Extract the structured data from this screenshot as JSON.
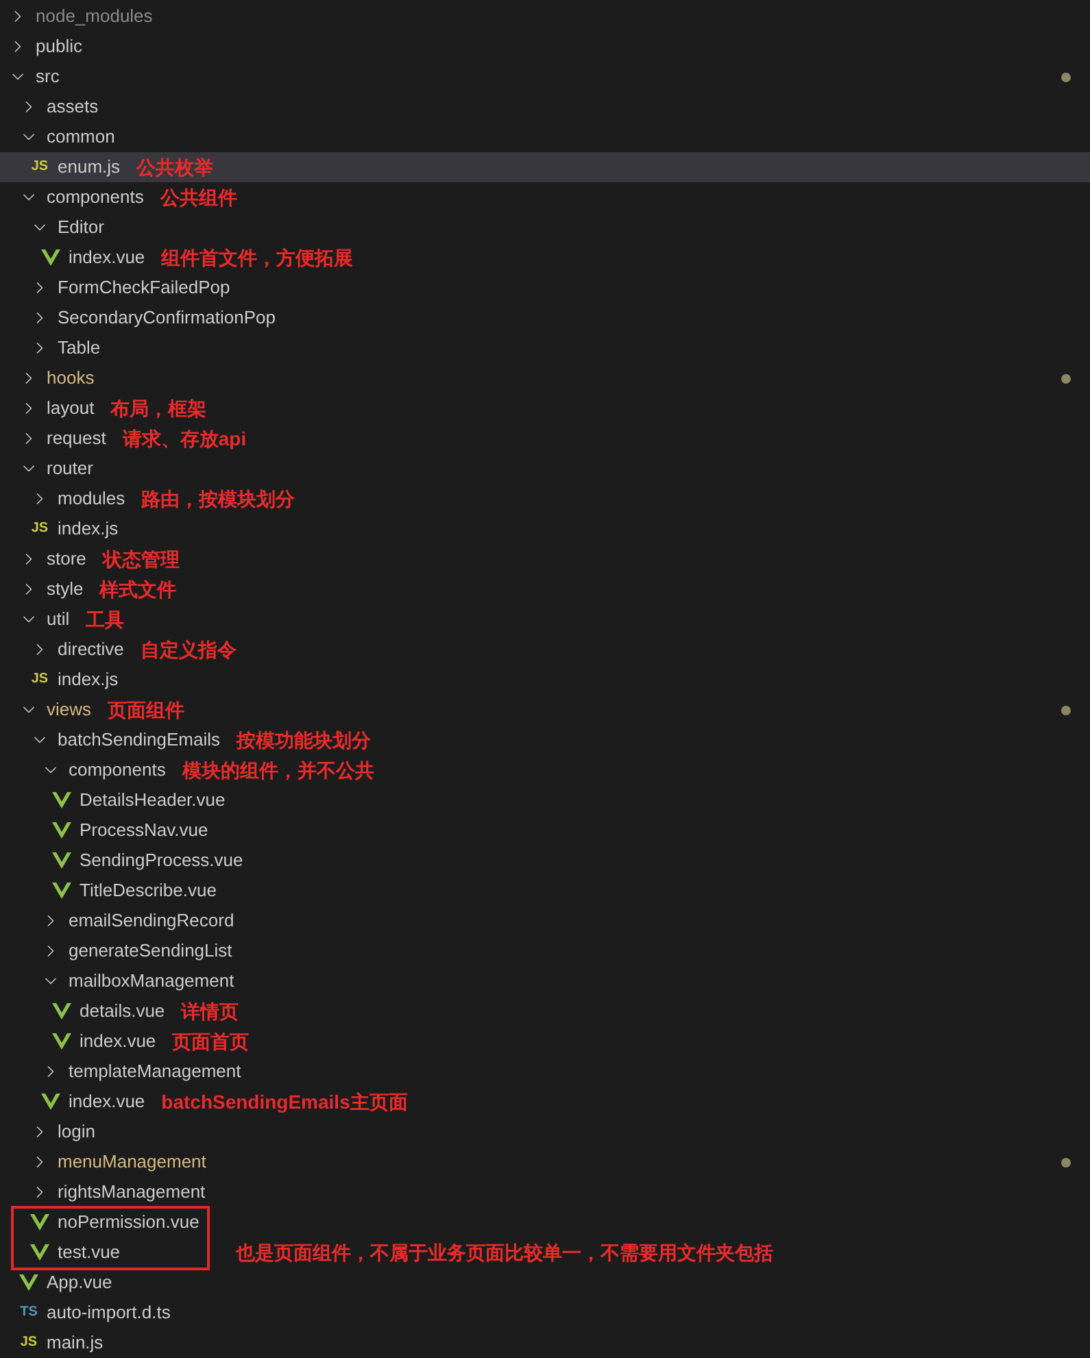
{
  "explorer": {
    "tree": [
      {
        "name": "node_modules",
        "kind": "folder",
        "expanded": false,
        "ignored": true,
        "modified": false,
        "changed": false,
        "selected": false
      },
      {
        "name": "public",
        "kind": "folder",
        "expanded": false,
        "ignored": false,
        "modified": false,
        "changed": false,
        "selected": false
      },
      {
        "name": "src",
        "kind": "folder",
        "expanded": true,
        "ignored": false,
        "modified": false,
        "changed": true,
        "selected": false,
        "children": [
          {
            "name": "assets",
            "kind": "folder",
            "expanded": false,
            "ignored": false,
            "modified": false,
            "changed": false,
            "selected": false
          },
          {
            "name": "common",
            "kind": "folder",
            "expanded": true,
            "ignored": false,
            "modified": false,
            "changed": false,
            "selected": false,
            "children": [
              {
                "name": "enum.js",
                "kind": "js",
                "badge": "JS",
                "ignored": false,
                "modified": false,
                "changed": false,
                "selected": true,
                "note": "公共枚举"
              }
            ]
          },
          {
            "name": "components",
            "kind": "folder",
            "expanded": true,
            "ignored": false,
            "modified": false,
            "changed": false,
            "selected": false,
            "note": "公共组件",
            "children": [
              {
                "name": "Editor",
                "kind": "folder",
                "expanded": true,
                "ignored": false,
                "modified": false,
                "changed": false,
                "selected": false,
                "children": [
                  {
                    "name": "index.vue",
                    "kind": "vue",
                    "ignored": false,
                    "modified": false,
                    "changed": false,
                    "selected": false,
                    "note": "组件首文件，方便拓展"
                  }
                ]
              },
              {
                "name": "FormCheckFailedPop",
                "kind": "folder",
                "expanded": false,
                "ignored": false,
                "modified": false,
                "changed": false,
                "selected": false
              },
              {
                "name": "SecondaryConfirmationPop",
                "kind": "folder",
                "expanded": false,
                "ignored": false,
                "modified": false,
                "changed": false,
                "selected": false
              },
              {
                "name": "Table",
                "kind": "folder",
                "expanded": false,
                "ignored": false,
                "modified": false,
                "changed": false,
                "selected": false
              }
            ]
          },
          {
            "name": "hooks",
            "kind": "folder",
            "expanded": false,
            "ignored": false,
            "modified": true,
            "changed": true,
            "selected": false
          },
          {
            "name": "layout",
            "kind": "folder",
            "expanded": false,
            "ignored": false,
            "modified": false,
            "changed": false,
            "selected": false,
            "note": "布局，框架"
          },
          {
            "name": "request",
            "kind": "folder",
            "expanded": false,
            "ignored": false,
            "modified": false,
            "changed": false,
            "selected": false,
            "note": "请求、存放api"
          },
          {
            "name": "router",
            "kind": "folder",
            "expanded": true,
            "ignored": false,
            "modified": false,
            "changed": false,
            "selected": false,
            "children": [
              {
                "name": "modules",
                "kind": "folder",
                "expanded": false,
                "ignored": false,
                "modified": false,
                "changed": false,
                "selected": false,
                "note": "路由，按模块划分"
              },
              {
                "name": "index.js",
                "kind": "js",
                "badge": "JS",
                "ignored": false,
                "modified": false,
                "changed": false,
                "selected": false
              }
            ]
          },
          {
            "name": "store",
            "kind": "folder",
            "expanded": false,
            "ignored": false,
            "modified": false,
            "changed": false,
            "selected": false,
            "note": "状态管理"
          },
          {
            "name": "style",
            "kind": "folder",
            "expanded": false,
            "ignored": false,
            "modified": false,
            "changed": false,
            "selected": false,
            "note": "样式文件"
          },
          {
            "name": "util",
            "kind": "folder",
            "expanded": true,
            "ignored": false,
            "modified": false,
            "changed": false,
            "selected": false,
            "note": "工具",
            "children": [
              {
                "name": "directive",
                "kind": "folder",
                "expanded": false,
                "ignored": false,
                "modified": false,
                "changed": false,
                "selected": false,
                "note": "自定义指令"
              },
              {
                "name": "index.js",
                "kind": "js",
                "badge": "JS",
                "ignored": false,
                "modified": false,
                "changed": false,
                "selected": false
              }
            ]
          },
          {
            "name": "views",
            "kind": "folder",
            "expanded": true,
            "ignored": false,
            "modified": true,
            "changed": true,
            "selected": false,
            "note": "页面组件",
            "children": [
              {
                "name": "batchSendingEmails",
                "kind": "folder",
                "expanded": true,
                "ignored": false,
                "modified": false,
                "changed": false,
                "selected": false,
                "note": "按模功能块划分",
                "children": [
                  {
                    "name": "components",
                    "kind": "folder",
                    "expanded": true,
                    "ignored": false,
                    "modified": false,
                    "changed": false,
                    "selected": false,
                    "note": "模块的组件，并不公共",
                    "children": [
                      {
                        "name": "DetailsHeader.vue",
                        "kind": "vue",
                        "ignored": false,
                        "modified": false,
                        "changed": false,
                        "selected": false
                      },
                      {
                        "name": "ProcessNav.vue",
                        "kind": "vue",
                        "ignored": false,
                        "modified": false,
                        "changed": false,
                        "selected": false
                      },
                      {
                        "name": "SendingProcess.vue",
                        "kind": "vue",
                        "ignored": false,
                        "modified": false,
                        "changed": false,
                        "selected": false
                      },
                      {
                        "name": "TitleDescribe.vue",
                        "kind": "vue",
                        "ignored": false,
                        "modified": false,
                        "changed": false,
                        "selected": false
                      }
                    ]
                  },
                  {
                    "name": "emailSendingRecord",
                    "kind": "folder",
                    "expanded": false,
                    "ignored": false,
                    "modified": false,
                    "changed": false,
                    "selected": false
                  },
                  {
                    "name": "generateSendingList",
                    "kind": "folder",
                    "expanded": false,
                    "ignored": false,
                    "modified": false,
                    "changed": false,
                    "selected": false
                  },
                  {
                    "name": "mailboxManagement",
                    "kind": "folder",
                    "expanded": true,
                    "ignored": false,
                    "modified": false,
                    "changed": false,
                    "selected": false,
                    "children": [
                      {
                        "name": "details.vue",
                        "kind": "vue",
                        "ignored": false,
                        "modified": false,
                        "changed": false,
                        "selected": false,
                        "note": "详情页"
                      },
                      {
                        "name": "index.vue",
                        "kind": "vue",
                        "ignored": false,
                        "modified": false,
                        "changed": false,
                        "selected": false,
                        "note": "页面首页"
                      }
                    ]
                  },
                  {
                    "name": "templateManagement",
                    "kind": "folder",
                    "expanded": false,
                    "ignored": false,
                    "modified": false,
                    "changed": false,
                    "selected": false
                  },
                  {
                    "name": "index.vue",
                    "kind": "vue",
                    "ignored": false,
                    "modified": false,
                    "changed": false,
                    "selected": false,
                    "note": "batchSendingEmails主页面"
                  }
                ]
              },
              {
                "name": "login",
                "kind": "folder",
                "expanded": false,
                "ignored": false,
                "modified": false,
                "changed": false,
                "selected": false
              },
              {
                "name": "menuManagement",
                "kind": "folder",
                "expanded": false,
                "ignored": false,
                "modified": true,
                "changed": true,
                "selected": false
              },
              {
                "name": "rightsManagement",
                "kind": "folder",
                "expanded": false,
                "ignored": false,
                "modified": false,
                "changed": false,
                "selected": false
              },
              {
                "name": "noPermission.vue",
                "kind": "vue",
                "ignored": false,
                "modified": false,
                "changed": false,
                "selected": false,
                "boxed": true
              },
              {
                "name": "test.vue",
                "kind": "vue",
                "ignored": false,
                "modified": false,
                "changed": false,
                "selected": false,
                "boxed": true,
                "note": "也是页面组件，不属于业务页面比较单一，不需要用文件夹包括"
              }
            ]
          },
          {
            "name": "App.vue",
            "kind": "vue",
            "ignored": false,
            "modified": false,
            "changed": false,
            "selected": false
          },
          {
            "name": "auto-import.d.ts",
            "kind": "ts",
            "badge": "TS",
            "ignored": false,
            "modified": false,
            "changed": false,
            "selected": false
          },
          {
            "name": "main.js",
            "kind": "js",
            "badge": "JS",
            "ignored": false,
            "modified": false,
            "changed": false,
            "selected": false
          }
        ]
      }
    ]
  }
}
